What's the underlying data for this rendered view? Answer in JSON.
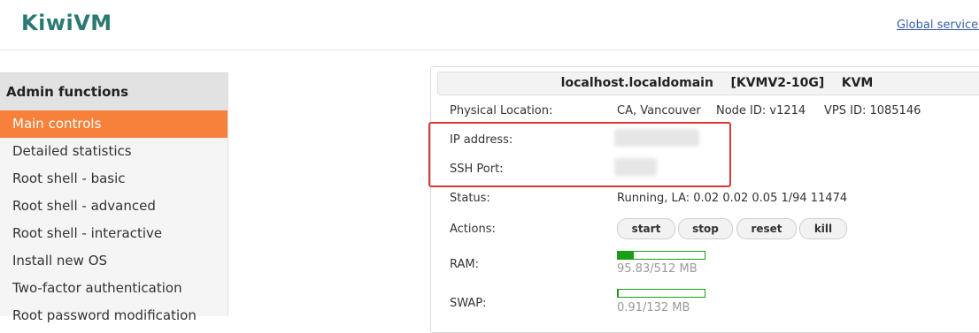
{
  "header": {
    "logo": "KiwiVM",
    "global_link": "Global service s"
  },
  "sidebar": {
    "heading": "Admin functions",
    "items": [
      {
        "label": "Main controls",
        "active": true
      },
      {
        "label": "Detailed statistics"
      },
      {
        "label": "Root shell - basic"
      },
      {
        "label": "Root shell - advanced"
      },
      {
        "label": "Root shell - interactive"
      },
      {
        "label": "Install new OS"
      },
      {
        "label": "Two-factor authentication"
      },
      {
        "label": "Root password modification"
      }
    ]
  },
  "panel": {
    "title": "localhost.localdomain    [KVMV2-10G]    KVM",
    "physical_location_label": "Physical Location:",
    "physical_location_value": "CA, Vancouver",
    "node_id": "Node ID: v1214",
    "vps_id": "VPS ID: 1085146",
    "ip_label": "IP address:",
    "ssh_label": "SSH Port:",
    "status_label": "Status:",
    "status_value": "Running, LA: 0.02 0.02 0.05 1/94 11474",
    "actions_label": "Actions:",
    "actions": [
      "start",
      "stop",
      "reset",
      "kill"
    ],
    "ram_label": "RAM:",
    "ram_text": "95.83/512 MB",
    "ram_fraction": 0.187,
    "swap_label": "SWAP:",
    "swap_text": "0.91/132 MB",
    "swap_fraction": 0.007
  },
  "colors": {
    "accent": "#f7813a",
    "logo": "#2a7a72",
    "highlight": "#d83a3a",
    "usage_bar": "#1a9e1a"
  }
}
